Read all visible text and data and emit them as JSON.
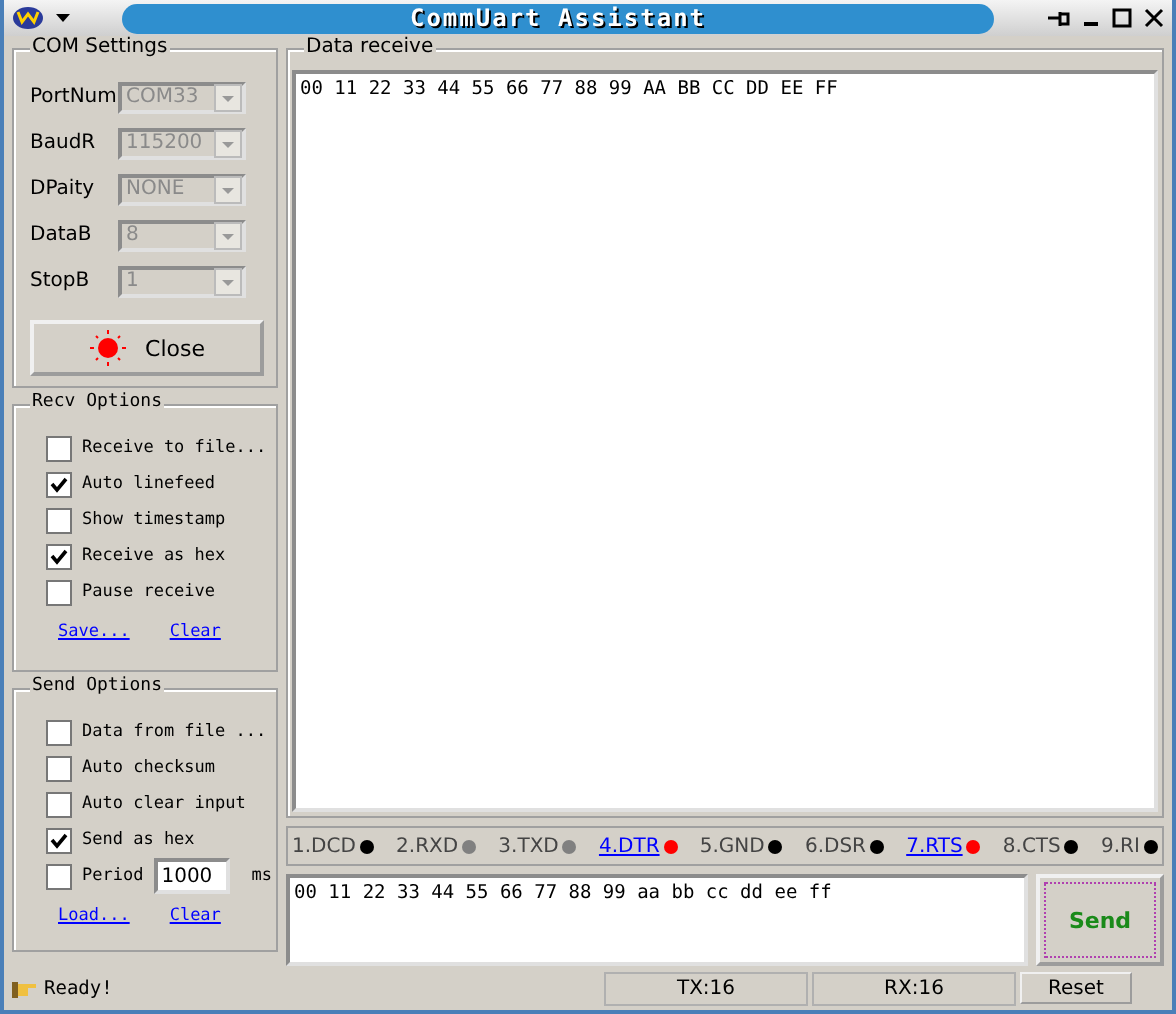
{
  "window": {
    "title": "CommUart Assistant"
  },
  "com_settings": {
    "title": "COM Settings",
    "fields": [
      {
        "label": "PortNum",
        "value": "COM33",
        "disabled": true
      },
      {
        "label": "BaudR",
        "value": "115200",
        "disabled": true
      },
      {
        "label": "DPaity",
        "value": "NONE",
        "disabled": true
      },
      {
        "label": "DataB",
        "value": "8",
        "disabled": true
      },
      {
        "label": "StopB",
        "value": "1",
        "disabled": true
      }
    ],
    "button": {
      "label": "Close",
      "on": true
    }
  },
  "recv_options": {
    "title": "Recv Options",
    "options": [
      {
        "label": "Receive to file...",
        "checked": false
      },
      {
        "label": "Auto linefeed",
        "checked": true
      },
      {
        "label": "Show timestamp",
        "checked": false
      },
      {
        "label": "Receive as hex",
        "checked": true
      },
      {
        "label": "Pause receive",
        "checked": false
      }
    ],
    "links": [
      "Save...",
      "Clear"
    ]
  },
  "send_options": {
    "title": "Send Options",
    "options": [
      {
        "label": "Data from file ...",
        "checked": false
      },
      {
        "label": "Auto checksum",
        "checked": false
      },
      {
        "label": "Auto clear input",
        "checked": false
      },
      {
        "label": "Send as hex",
        "checked": true
      }
    ],
    "period": {
      "label": "Period",
      "checked": false,
      "value": "1000",
      "unit": "ms"
    },
    "links": [
      "Load...",
      "Clear"
    ]
  },
  "data_receive": {
    "title": "Data receive",
    "text": "00 11 22 33 44 55 66 77 88 99 AA BB CC DD EE FF"
  },
  "pins": [
    {
      "label": "1.DCD",
      "color": "#000000",
      "link": false
    },
    {
      "label": "2.RXD",
      "color": "#808080",
      "link": false
    },
    {
      "label": "3.TXD",
      "color": "#808080",
      "link": false
    },
    {
      "label": "4.DTR",
      "color": "#ff0000",
      "link": true
    },
    {
      "label": "5.GND",
      "color": "#000000",
      "link": false
    },
    {
      "label": "6.DSR",
      "color": "#000000",
      "link": false
    },
    {
      "label": "7.RTS",
      "color": "#ff0000",
      "link": true
    },
    {
      "label": "8.CTS",
      "color": "#000000",
      "link": false
    },
    {
      "label": "9.RI",
      "color": "#000000",
      "link": false
    }
  ],
  "send": {
    "value": "00 11 22 33 44 55 66 77 88 99 aa bb cc dd ee ff",
    "button": "Send"
  },
  "status_bar": {
    "status": "Ready!",
    "tx": "TX:16",
    "rx": "RX:16",
    "reset": "Reset"
  }
}
